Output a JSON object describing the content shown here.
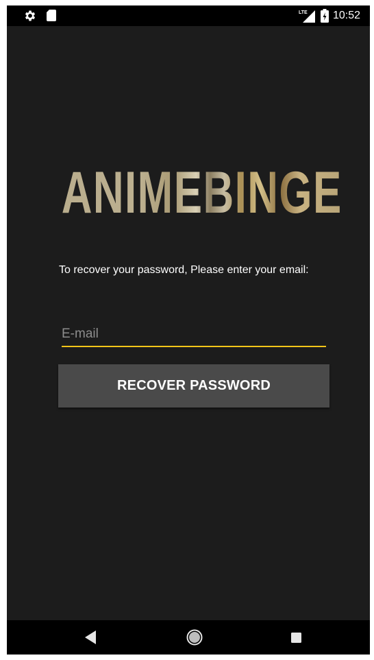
{
  "status_bar": {
    "time": "10:52",
    "network": "LTE",
    "icons": [
      "settings-icon",
      "sd-card-icon",
      "lte-signal-icon",
      "battery-icon"
    ]
  },
  "logo": {
    "text": "ANIMEBINGE"
  },
  "form": {
    "instructions": "To recover your password, Please enter your email:",
    "email_placeholder": "E-mail",
    "email_value": "",
    "submit_label": "RECOVER PASSWORD"
  },
  "colors": {
    "background": "#1c1c1c",
    "accent_underline": "#f5c518",
    "button_background": "#4a4a4a",
    "status_bar": "#000000"
  },
  "nav_bar": {
    "icons": [
      "back-icon",
      "home-icon",
      "recents-icon"
    ]
  }
}
